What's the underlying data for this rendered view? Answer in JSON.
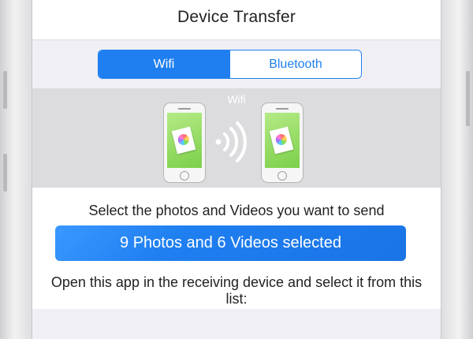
{
  "nav": {
    "title": "Device Transfer"
  },
  "segmented": {
    "options": [
      {
        "label": "Wifi",
        "selected": true
      },
      {
        "label": "Bluetooth",
        "selected": false
      }
    ],
    "accent_color": "#1f7ff0"
  },
  "illustration": {
    "caption": "Wifi",
    "icons": [
      "phone-icon",
      "photos-app-icon",
      "wifi-signal-icon",
      "phone-icon",
      "photos-app-icon"
    ]
  },
  "main": {
    "prompt": "Select the photos and Videos you want to send",
    "selection_button": "9 Photos and 6 Videos selected",
    "info": "Open this app in the receiving device and select it from this list:"
  }
}
